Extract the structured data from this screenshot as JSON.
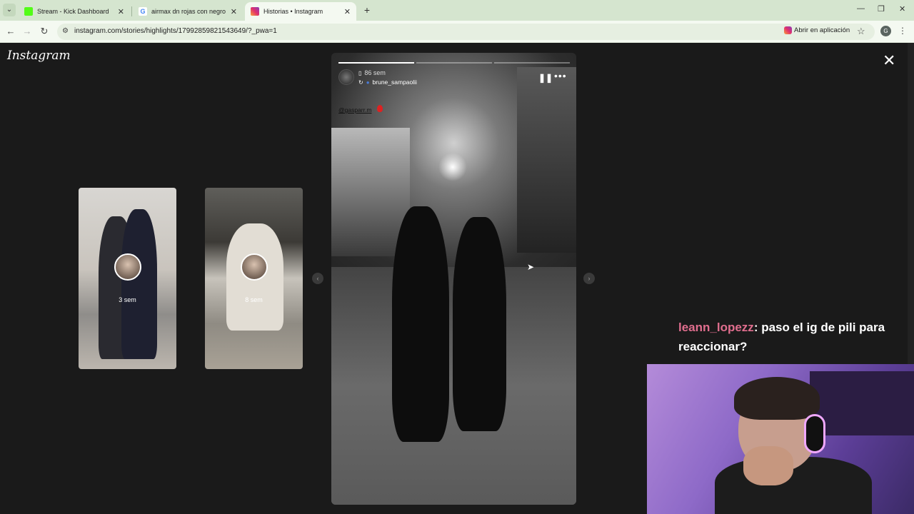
{
  "browser": {
    "tabs": [
      {
        "title": "Stream - Kick Dashboard",
        "favicon_color": "#53fc18",
        "active": false
      },
      {
        "title": "airmax dn rojas con negro - Bu",
        "favicon_color": "#4285f4",
        "active": false
      },
      {
        "title": "Historias • Instagram",
        "favicon_color": "#e1306c",
        "active": true
      }
    ],
    "url": "instagram.com/stories/highlights/17992859821543649/?_pwa=1",
    "open_in_app_label": "Abrir en aplicación",
    "profile_initial": "G"
  },
  "instagram": {
    "logo": "Instagram",
    "previews": [
      {
        "time": "3 sem"
      },
      {
        "time": "8 sem"
      }
    ],
    "story": {
      "time_ago": "86 sem",
      "username": "brune_sampaolii",
      "mention": "@gasparr.m",
      "progress": [
        1.0,
        0.0,
        0.0
      ]
    }
  },
  "stream": {
    "chat_user": "leann_lopezz",
    "chat_message": ": paso el ig de pili para reaccionar?"
  }
}
